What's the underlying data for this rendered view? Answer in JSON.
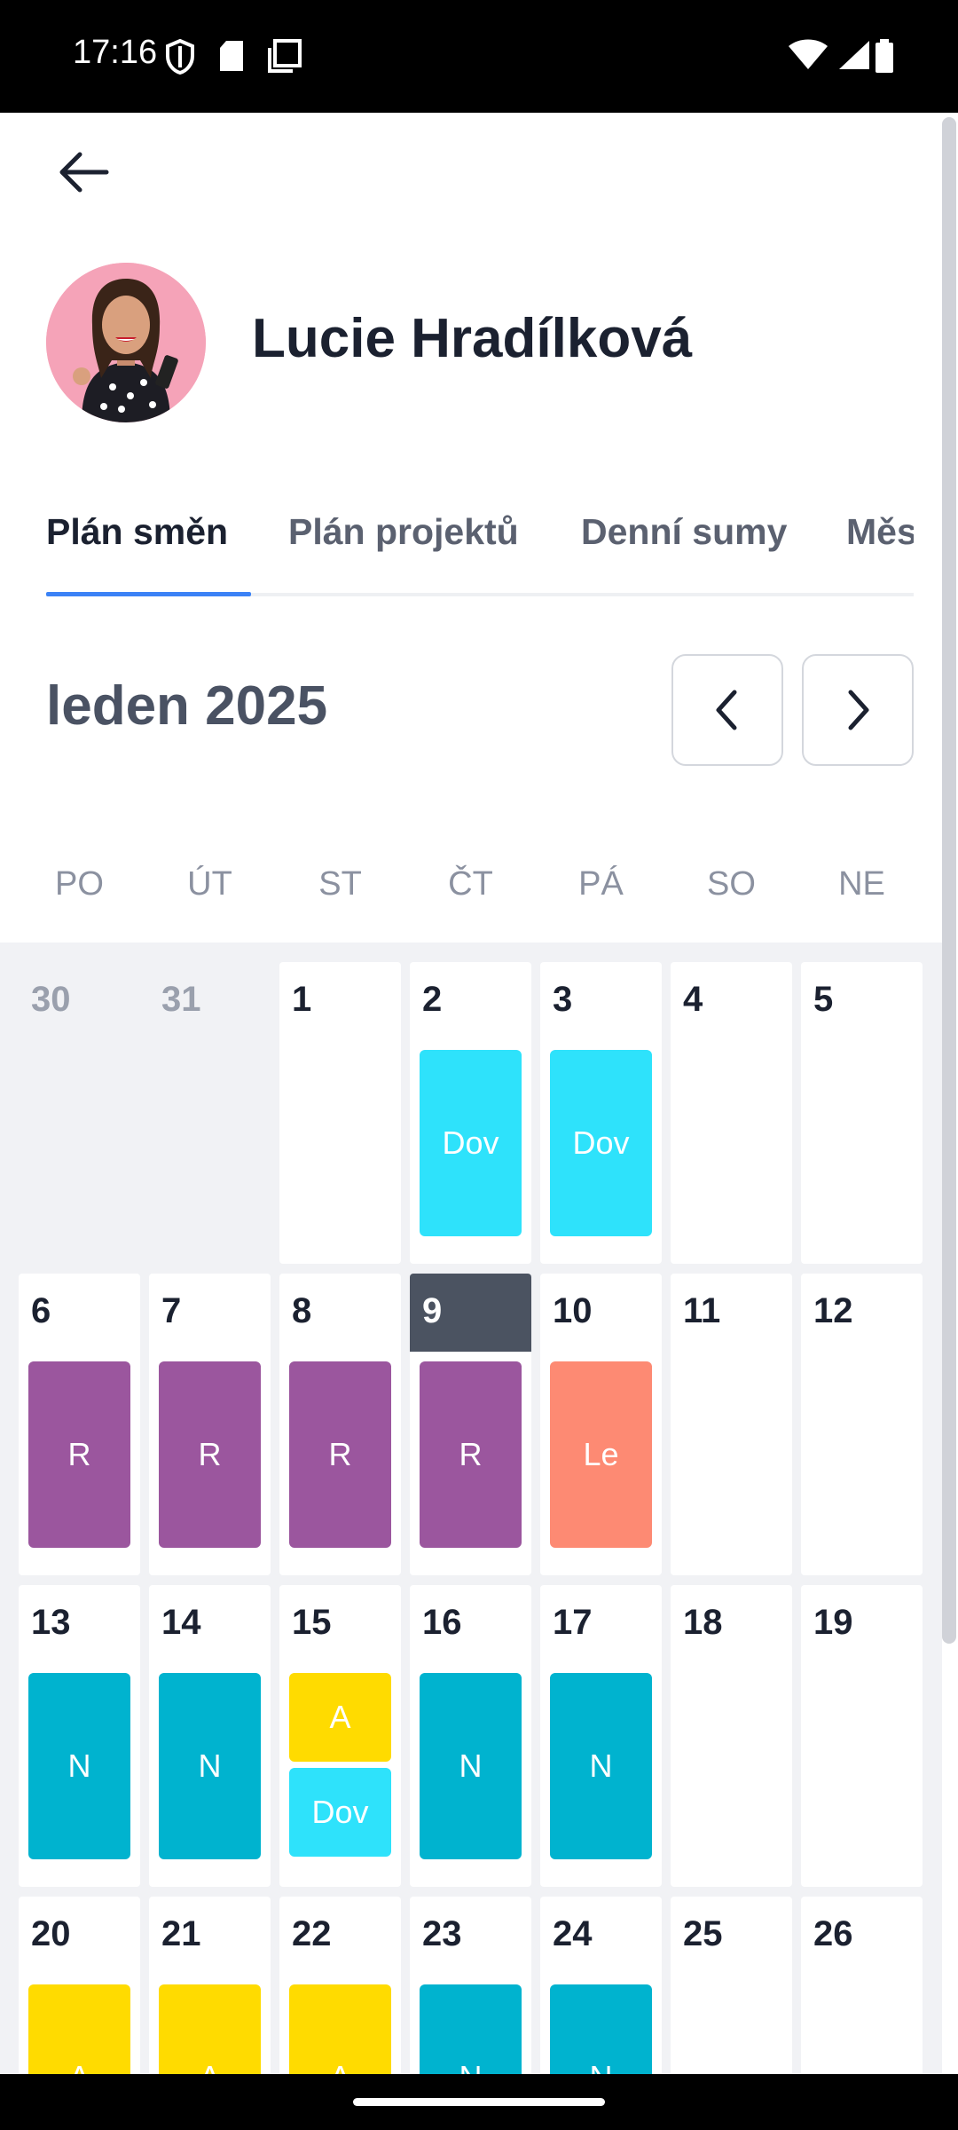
{
  "status_bar": {
    "time": "17:16",
    "icons": [
      "shield-icon",
      "sd-card-icon",
      "screenshot-icon",
      "wifi-icon",
      "signal-icon",
      "battery-icon"
    ]
  },
  "profile": {
    "name": "Lucie Hradílková",
    "avatar": "profile-photo"
  },
  "tabs": [
    {
      "label": "Plán směn",
      "active": true
    },
    {
      "label": "Plán projektů",
      "active": false
    },
    {
      "label": "Denní sumy",
      "active": false
    },
    {
      "label": "Měsíční sumy",
      "active": false
    }
  ],
  "calendar": {
    "month_label": "leden 2025",
    "weekdays": [
      "PO",
      "ÚT",
      "ST",
      "ČT",
      "PÁ",
      "SO",
      "NE"
    ],
    "weeks": [
      [
        {
          "day": "30",
          "outside": true,
          "shifts": []
        },
        {
          "day": "31",
          "outside": true,
          "shifts": []
        },
        {
          "day": "1",
          "shifts": []
        },
        {
          "day": "2",
          "shifts": [
            {
              "label": "Dov",
              "color": "#2ee2fb"
            }
          ]
        },
        {
          "day": "3",
          "shifts": [
            {
              "label": "Dov",
              "color": "#2ee2fb"
            }
          ]
        },
        {
          "day": "4",
          "shifts": []
        },
        {
          "day": "5",
          "shifts": []
        }
      ],
      [
        {
          "day": "6",
          "shifts": [
            {
              "label": "R",
              "color": "#9b569e"
            }
          ]
        },
        {
          "day": "7",
          "shifts": [
            {
              "label": "R",
              "color": "#9b569e"
            }
          ]
        },
        {
          "day": "8",
          "shifts": [
            {
              "label": "R",
              "color": "#9b569e"
            }
          ]
        },
        {
          "day": "9",
          "today": true,
          "shifts": [
            {
              "label": "R",
              "color": "#9b569e"
            }
          ]
        },
        {
          "day": "10",
          "shifts": [
            {
              "label": "Le",
              "color": "#fd8a73"
            }
          ]
        },
        {
          "day": "11",
          "shifts": []
        },
        {
          "day": "12",
          "shifts": []
        }
      ],
      [
        {
          "day": "13",
          "shifts": [
            {
              "label": "N",
              "color": "#00b3cf"
            }
          ]
        },
        {
          "day": "14",
          "shifts": [
            {
              "label": "N",
              "color": "#00b3cf"
            }
          ]
        },
        {
          "day": "15",
          "shifts": [
            {
              "label": "A",
              "color": "#ffdb00"
            },
            {
              "label": "Dov",
              "color": "#2ee2fb"
            }
          ]
        },
        {
          "day": "16",
          "shifts": [
            {
              "label": "N",
              "color": "#00b3cf"
            }
          ]
        },
        {
          "day": "17",
          "shifts": [
            {
              "label": "N",
              "color": "#00b3cf"
            }
          ]
        },
        {
          "day": "18",
          "shifts": []
        },
        {
          "day": "19",
          "shifts": []
        }
      ],
      [
        {
          "day": "20",
          "shifts": [
            {
              "label": "A",
              "color": "#ffdb00"
            }
          ]
        },
        {
          "day": "21",
          "shifts": [
            {
              "label": "A",
              "color": "#ffdb00"
            }
          ]
        },
        {
          "day": "22",
          "shifts": [
            {
              "label": "A",
              "color": "#ffdb00"
            }
          ]
        },
        {
          "day": "23",
          "shifts": [
            {
              "label": "N",
              "color": "#00b3cf"
            }
          ]
        },
        {
          "day": "24",
          "shifts": [
            {
              "label": "N",
              "color": "#00b3cf"
            }
          ]
        },
        {
          "day": "25",
          "shifts": []
        },
        {
          "day": "26",
          "shifts": []
        }
      ]
    ]
  },
  "colors": {
    "accent": "#3b82f6",
    "today_header": "#4b5361"
  }
}
